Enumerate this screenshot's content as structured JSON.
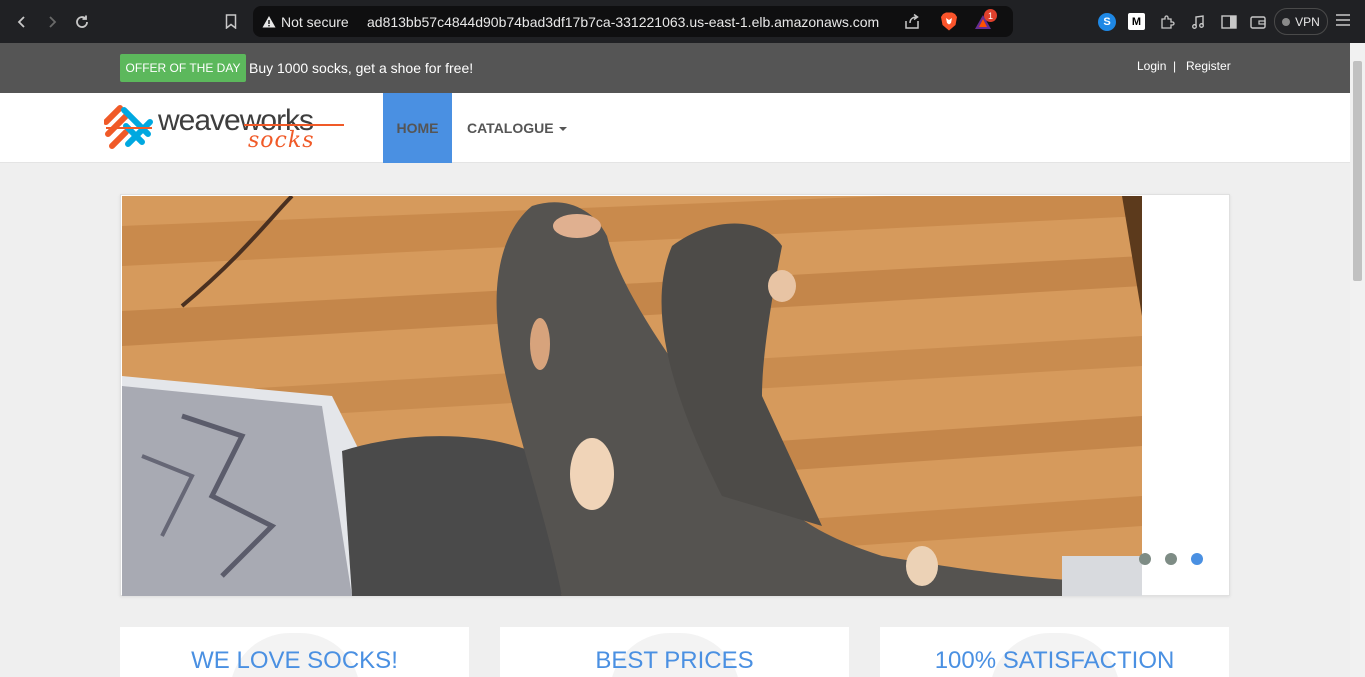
{
  "browser": {
    "security_label": "Not secure",
    "url": "ad813bb57c4844d90b74bad3df17b7ca-331221063.us-east-1.elb.amazonaws.com",
    "notification_count": "1",
    "vpn_label": "VPN",
    "icons": [
      "back-icon",
      "forward-icon",
      "reload-icon",
      "bookmark-icon",
      "warning-icon",
      "share-icon",
      "brave-shield-icon",
      "brave-rewards-icon",
      "shazam-icon",
      "medium-icon",
      "puzzle-icon",
      "music-icon",
      "sidebar-icon",
      "wallet-icon",
      "menu-icon"
    ]
  },
  "topbar": {
    "offer_badge": "OFFER OF THE DAY",
    "offer_text": "Buy 1000 socks, get a shoe for free!",
    "login": "Login",
    "separator": "|",
    "register": "Register"
  },
  "navbar": {
    "logo_weave": "weave",
    "logo_works": "works",
    "logo_socks": "socks",
    "home": "HOME",
    "catalogue": "CATALOGUE"
  },
  "carousel": {
    "slide_count": 3,
    "active_index": 2
  },
  "features": [
    {
      "title": "WE LOVE SOCKS!"
    },
    {
      "title": "BEST PRICES"
    },
    {
      "title": "100% SATISFACTION"
    }
  ],
  "colors": {
    "accent": "#4a90e2",
    "offer_green": "#5cb85c",
    "topbar": "#555555",
    "brand_orange": "#f05a28"
  }
}
